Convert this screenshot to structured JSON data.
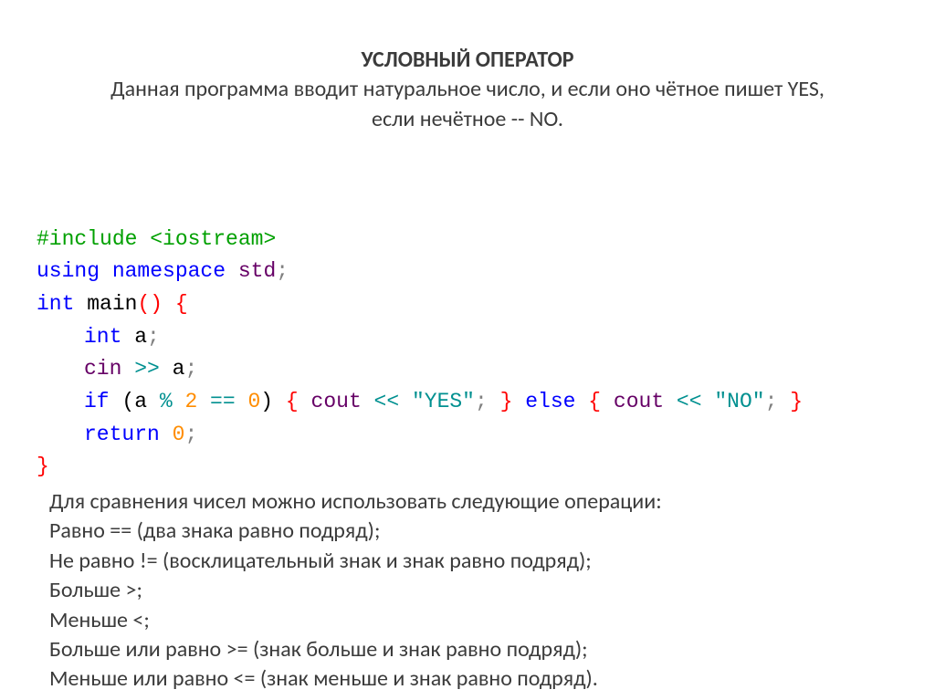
{
  "heading": {
    "title": "УСЛОВНЫЙ ОПЕРАТОР",
    "line1": "Данная программа вводит натуральное число, и если оно чётное пишет YES,",
    "line2": "если нечётное -- NO."
  },
  "code": {
    "include_hash": "#include",
    "include_hdr": " <iostream>",
    "using": "using",
    "namespace": " namespace",
    "std": " std",
    "semicolon": ";",
    "int": "int",
    "main": " main",
    "parens": "()",
    "space": " ",
    "lbrace": "{",
    "rbrace": "}",
    "decl_a": " a",
    "cin": "cin",
    "shr": " >>",
    "a_ref": " a",
    "if": "if",
    "cond_open": " (a ",
    "mod": "% ",
    "two": "2",
    "eqeq": " == ",
    "zero": "0",
    "cond_close": ")",
    "cout": "cout",
    "shl": " <<",
    "yes": " \"YES\"",
    "else": "else",
    "no": " \"NO\"",
    "return": "return",
    "zero_ret": " 0"
  },
  "notes": {
    "n1": "Для сравнения чисел можно использовать следующие операции:",
    "n2": "Равно == (два знака равно подряд);",
    "n3": "Не равно != (восклицательный знак и знак равно подряд);",
    "n4": "Больше >;",
    "n5": "Меньше <;",
    "n6": "Больше или равно >= (знак больше и знак равно подряд);",
    "n7": "Меньше или равно <= (знак меньше и знак равно подряд)."
  }
}
